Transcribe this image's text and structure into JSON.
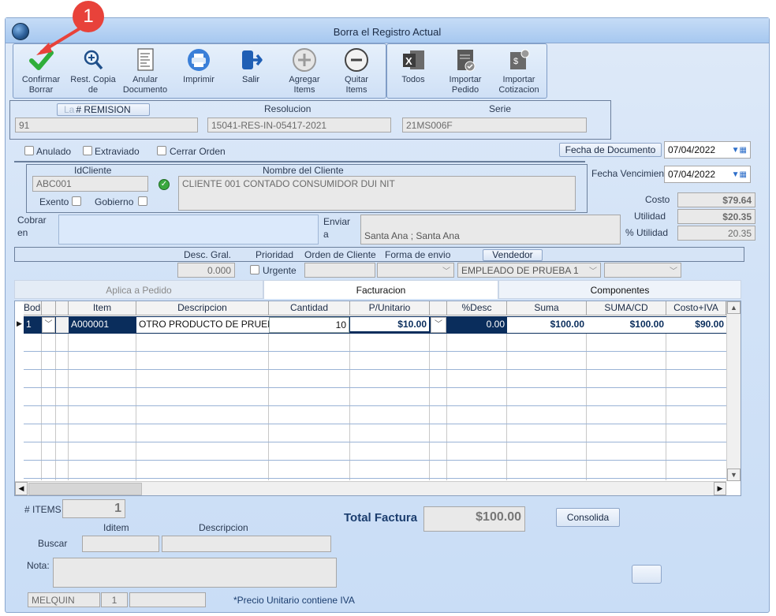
{
  "window": {
    "title": "Borra el Registro Actual"
  },
  "callout": {
    "number": "1"
  },
  "toolbar": {
    "confirm": "Confirmar\nBorrar",
    "restore": "Rest. Copia\nde",
    "void": "Anular\nDocumento",
    "print": "Imprimir",
    "exit": "Salir",
    "add_items": "Agregar\nItems",
    "remove_items": "Quitar\nItems",
    "all": "Todos",
    "import_order": "Importar\nPedido",
    "import_quote": "Importar\nCotizacion"
  },
  "header": {
    "remision_label": "# REMISION",
    "remision_hidden": "La",
    "remision_value": "91",
    "resolucion_label": "Resolucion",
    "resolucion_value": "15041-RES-IN-05417-2021",
    "serie_label": "Serie",
    "serie_value": "21MS006F"
  },
  "flags": {
    "anulado": "Anulado",
    "extraviado": "Extraviado",
    "cerrar_orden": "Cerrar Orden"
  },
  "dates": {
    "fecha_doc_label": "Fecha de  Documento",
    "fecha_doc_value": "07/04/2022",
    "fecha_venc_label": "Fecha Vencimien",
    "fecha_venc_value": "07/04/2022"
  },
  "client": {
    "id_label": "IdCliente",
    "id_value": "ABC001",
    "name_label": "Nombre del Cliente",
    "name_value": "CLIENTE 001 CONTADO CONSUMIDOR DUI NIT",
    "exento": "Exento",
    "gobierno": "Gobierno"
  },
  "totals_side": {
    "costo_label": "Costo",
    "costo_value": "$79.64",
    "utilidad_label": "Utilidad",
    "utilidad_value": "$20.35",
    "pct_utilidad_label": "% Utilidad",
    "pct_utilidad_value": "20.35"
  },
  "cobrar": {
    "label_1": "Cobrar",
    "label_2": "en",
    "value": ""
  },
  "enviar": {
    "label_1": "Enviar",
    "label_2": "a",
    "value": "Santa Ana ; Santa Ana"
  },
  "options": {
    "desc_gral_label": "Desc. Gral.",
    "desc_gral_value": "0.000",
    "prioridad_label": "Prioridad",
    "urgente": "Urgente",
    "orden_cliente_label": "Orden de Cliente",
    "forma_envio_label": "Forma de envio",
    "vendedor_label": "Vendedor",
    "vendedor_value": "EMPLEADO DE PRUEBA 1"
  },
  "tabs": [
    "Aplica a Pedido",
    "Facturacion",
    "Componentes"
  ],
  "grid": {
    "columns": [
      "Bodega",
      "",
      "",
      "Item",
      "Descripcion",
      "Cantidad",
      "P/Unitario",
      "",
      "%Desc",
      "Suma",
      "SUMA/CD",
      "Costo+IVA"
    ],
    "rows": [
      {
        "bodega": "1",
        "item": "A000001",
        "descripcion": "OTRO PRODUCTO DE PRUEBA",
        "cantidad": "10",
        "punitario": "$10.00",
        "desc": "0.00",
        "suma": "$100.00",
        "suma_cd": "$100.00",
        "costo_iva": "$90.00"
      }
    ]
  },
  "footer": {
    "items_label": "# ITEMS",
    "items_value": "1",
    "total_label": "Total Factura",
    "total_value": "$100.00",
    "consolida": "Consolida",
    "iditem_label": "Iditem",
    "descripcion_label": "Descripcion",
    "buscar_label": "Buscar",
    "nota_label": "Nota:",
    "user": "MELQUIN",
    "user_num": "1",
    "note": "*Precio Unitario contiene IVA"
  }
}
